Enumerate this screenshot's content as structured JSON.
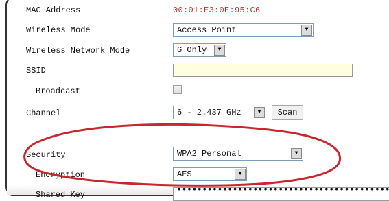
{
  "fields": {
    "mac_label": "MAC Address",
    "mac_value": "00:01:E3:0E:95:C6",
    "wireless_mode_label": "Wireless Mode",
    "wireless_mode_value": "Access Point",
    "network_mode_label": "Wireless Network Mode",
    "network_mode_value": "G Only",
    "ssid_label": "SSID",
    "ssid_value": "",
    "broadcast_label": "Broadcast",
    "broadcast_checked": false,
    "channel_label": "Channel",
    "channel_value": "6 - 2.437 GHz",
    "scan_label": "Scan",
    "security_label": "Security",
    "security_value": "WPA2 Personal",
    "encryption_label": "Encryption",
    "encryption_value": "AES",
    "shared_key_label": "Shared Key",
    "shared_key_mask": "••••••••••••••••••••••••••••••••••••••••••"
  },
  "colors": {
    "mac_value": "#b83232",
    "ssid_background": "#ffffe0",
    "highlight_ring": "#c8272d"
  },
  "icons": {
    "dropdown": "chevron-down-icon"
  }
}
